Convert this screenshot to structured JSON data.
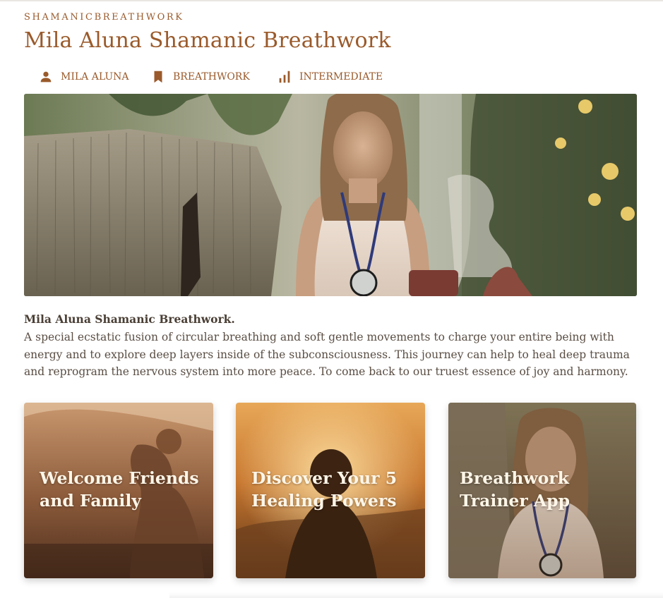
{
  "brand": "SHAMANICBREATHWORK",
  "title": "Mila Aluna Shamanic Breathwork",
  "meta": {
    "author": {
      "label": "MILA ALUNA",
      "icon": "person-icon"
    },
    "category": {
      "label": "BREATHWORK",
      "icon": "bookmark-icon"
    },
    "level": {
      "label": "INTERMEDIATE",
      "icon": "bar-chart-icon"
    }
  },
  "hero": {
    "icon": "hero-image"
  },
  "description": {
    "title": "Mila Aluna Shamanic Breathwork.",
    "text": "A special ecstatic fusion of circular breathing and soft gentle movements to charge your entire being with energy and to explore deep layers inside of the subconsciousness. This journey can help to heal deep trauma and reprogram the nervous system into more peace. To come back to our truest essence of joy and harmony."
  },
  "cards": [
    {
      "title": "Welcome Friends and Family"
    },
    {
      "title": "Discover Your 5 Healing Powers"
    },
    {
      "title": "Breathwork Trainer App"
    }
  ],
  "colors": {
    "accent": "#9a5a2b",
    "text": "#4a3f35",
    "card_text": "#fff6e8"
  }
}
